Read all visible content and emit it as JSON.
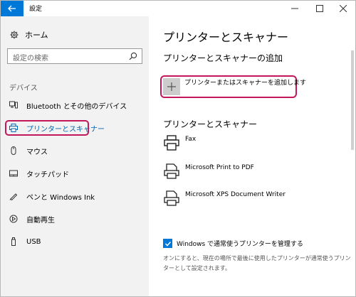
{
  "window": {
    "title": "設定"
  },
  "sidebar": {
    "home_label": "ホーム",
    "search_placeholder": "設定の検索",
    "category": "デバイス",
    "items": [
      {
        "label": "Bluetooth とその他のデバイス",
        "icon": "bluetooth-devices-icon"
      },
      {
        "label": "プリンターとスキャナー",
        "icon": "printer-icon",
        "active": true
      },
      {
        "label": "マウス",
        "icon": "mouse-icon"
      },
      {
        "label": "タッチパッド",
        "icon": "touchpad-icon"
      },
      {
        "label": "ペンと Windows Ink",
        "icon": "pen-icon"
      },
      {
        "label": "自動再生",
        "icon": "autoplay-icon"
      },
      {
        "label": "USB",
        "icon": "usb-icon"
      }
    ]
  },
  "main": {
    "title": "プリンターとスキャナー",
    "add_section_title": "プリンターとスキャナーの追加",
    "add_button_label": "プリンターまたはスキャナーを追加します",
    "list_title": "プリンターとスキャナー",
    "printers": [
      {
        "name": "Fax"
      },
      {
        "name": "Microsoft Print to PDF"
      },
      {
        "name": "Microsoft XPS Document Writer"
      }
    ],
    "checkbox_label": "Windows で通常使うプリンターを管理する",
    "checkbox_checked": true,
    "description": "オンにすると、現在の場所で最後に使用したプリンターが通常使うプリンターとして設定されます。"
  },
  "colors": {
    "accent": "#0078d7",
    "highlight_border": "#c2185b",
    "sidebar_bg": "#f2f2f2"
  }
}
